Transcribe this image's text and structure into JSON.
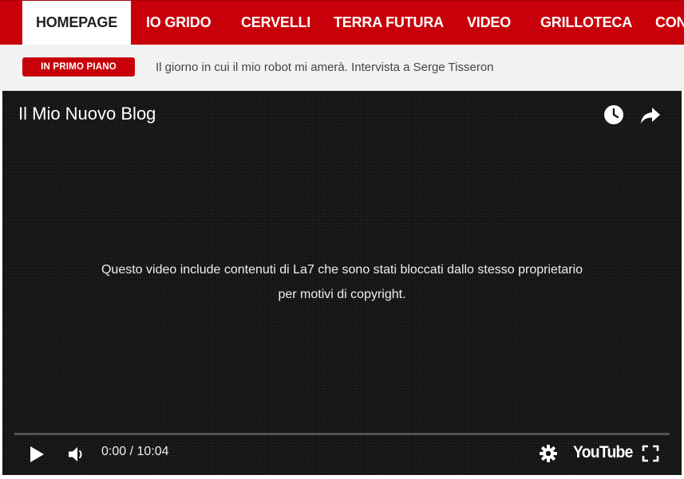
{
  "nav": {
    "items": [
      {
        "label": "HOMEPAGE",
        "active": true
      },
      {
        "label": "IO GRIDO",
        "active": false
      },
      {
        "label": "CERVELLI",
        "active": false
      },
      {
        "label": "TERRA FUTURA",
        "active": false
      },
      {
        "label": "VIDEO",
        "active": false
      },
      {
        "label": "GRILLOTECA",
        "active": false
      },
      {
        "label": "CON",
        "active": false
      }
    ]
  },
  "ticker": {
    "badge": "IN PRIMO PIANO",
    "headline": "Il giorno in cui il mio robot mi amerà. Intervista a Serge Tisseron"
  },
  "player": {
    "title": "Il Mio Nuovo Blog",
    "message_line1": "Questo video include contenuti di La7 che sono stati bloccati dallo stesso proprietario",
    "message_line2": "per motivi di copyright.",
    "current_time": "0:00",
    "separator": " / ",
    "duration": "10:04",
    "progress_percent": 0,
    "logo_text": "YouTube",
    "icons": {
      "watch_later": "clock-icon",
      "share": "share-icon",
      "play": "play-icon",
      "volume": "volume-icon",
      "settings": "gear-icon",
      "fullscreen": "fullscreen-icon"
    }
  },
  "colors": {
    "brand_red": "#c8000a",
    "ticker_bg": "#f2f2f2",
    "player_bg": "#151515"
  }
}
